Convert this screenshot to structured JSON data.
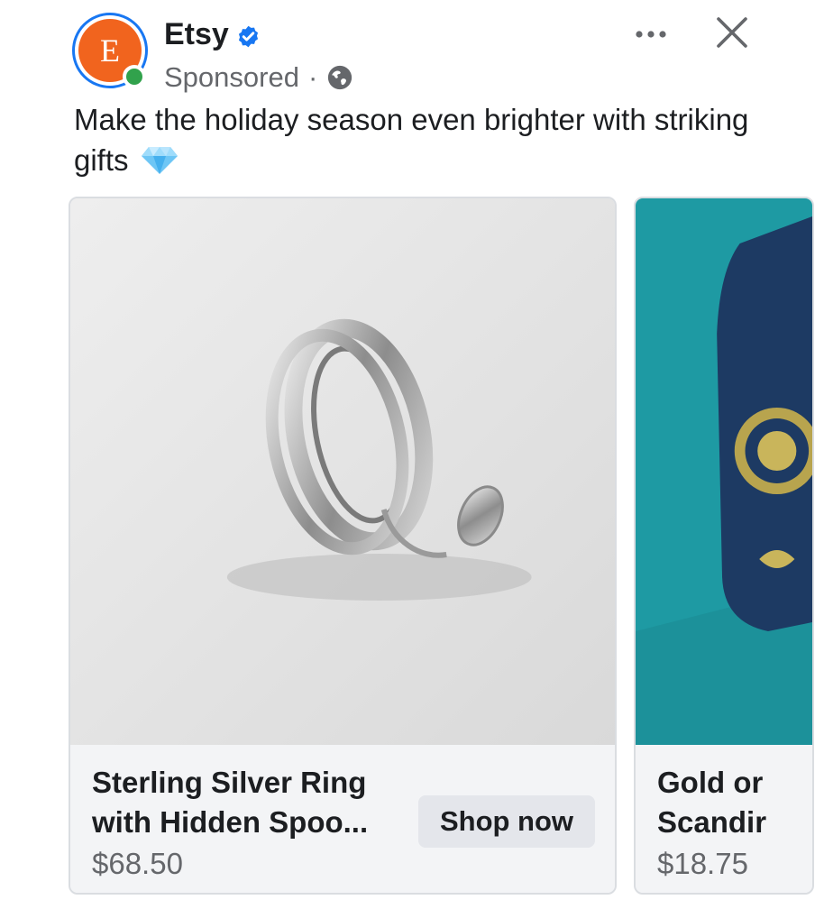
{
  "post": {
    "advertiser": {
      "name": "Etsy",
      "logo_letter": "E",
      "brand_color": "#f1641e",
      "verified": true,
      "sponsored_label": "Sponsored",
      "separator": "·",
      "audience_icon": "globe-icon"
    },
    "header_icons": [
      "more-options-icon",
      "close-icon"
    ],
    "caption": "Make the holiday season even brighter with striking gifts",
    "caption_emoji": "gem-icon"
  },
  "carousel": {
    "cards": [
      {
        "title_line_1": "Sterling Silver Ring",
        "title_line_2": "with Hidden Spoo...",
        "price": "$68.50",
        "cta_label": "Shop now",
        "image": "silver-ring-with-spoon-photo"
      },
      {
        "title_line_1": "Gold or",
        "title_line_2": "Scandir",
        "price": "$18.75",
        "image": "gold-pendant-on-teal-box-photo"
      }
    ]
  },
  "colors": {
    "accent_blue": "#1877f2",
    "online_green": "#31a24c",
    "secondary_text": "#65676b",
    "card_background": "#f3f4f6"
  }
}
